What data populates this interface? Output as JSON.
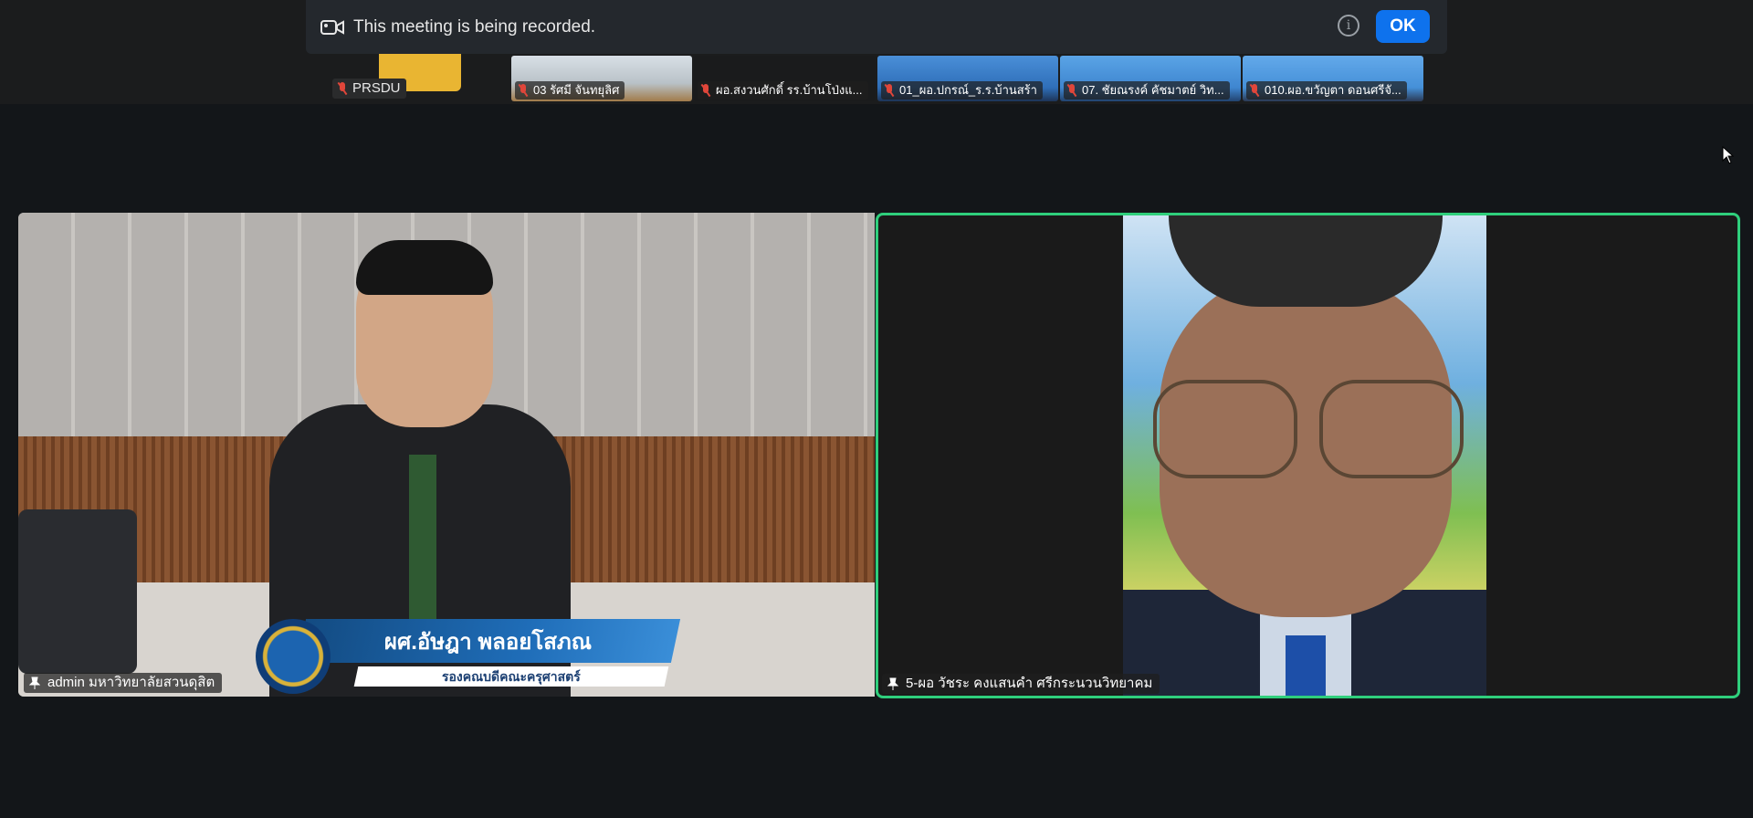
{
  "banner": {
    "message": "This meeting is being recorded.",
    "info_label": "i",
    "ok_label": "OK"
  },
  "gallery": {
    "first_label": "PRSDU",
    "thumbnails": [
      {
        "name": "03 รัศมี จันทยุลิศ"
      },
      {
        "name": "ผอ.สงวนศักดิ์ รร.บ้านโป่งแ..."
      },
      {
        "name": "01_ผอ.ปกรณ์_ร.ร.บ้านสร้า"
      },
      {
        "name": "07. ชัยณรงค์ คัชมาตย์ วิท..."
      },
      {
        "name": "010.ผอ.ขวัญตา ดอนศรีจั..."
      }
    ]
  },
  "tiles": {
    "left": {
      "name": "admin มหาวิทยาลัยสวนดุสิต",
      "caption_name": "ผศ.อัษฎา พลอยโสภณ",
      "caption_title": "รองคณบดีคณะครุศาสตร์"
    },
    "right": {
      "name": "5-ผอ วัชระ คงแสนคำ ศรีกระนวนวิทยาคม"
    }
  }
}
